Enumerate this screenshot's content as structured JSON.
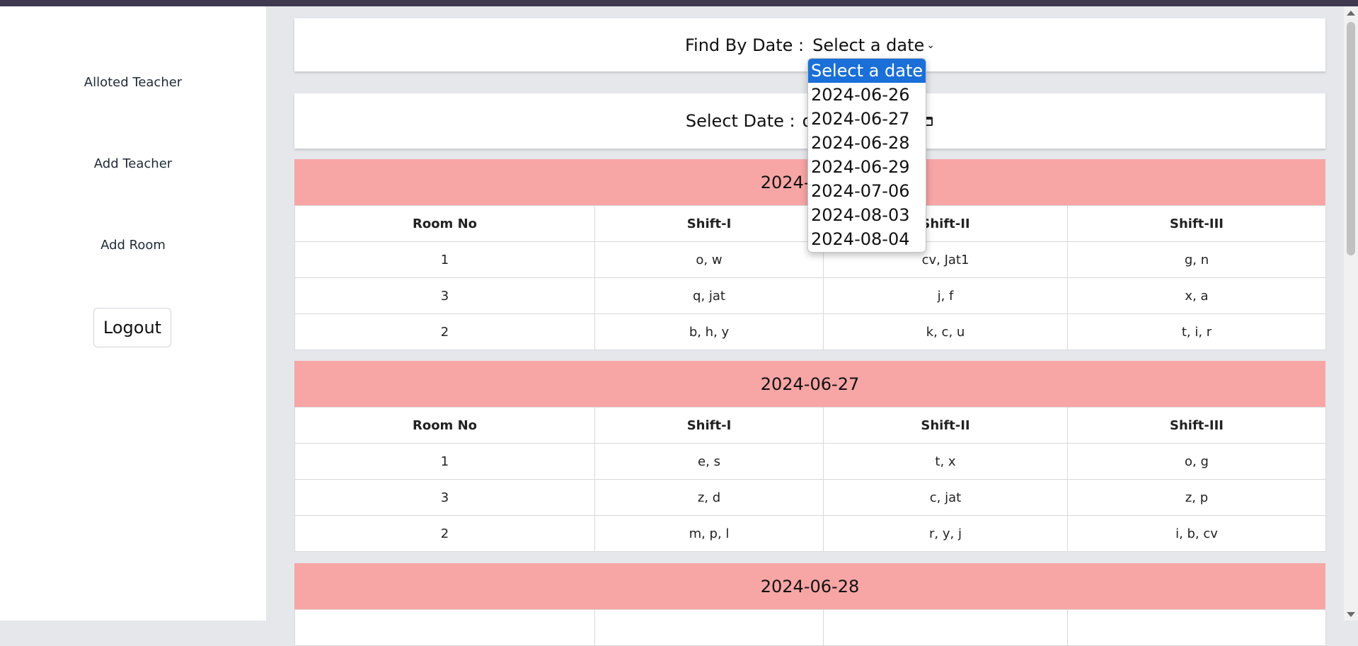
{
  "sidebar": {
    "links": [
      {
        "label": "Alloted Teacher"
      },
      {
        "label": "Add Teacher"
      },
      {
        "label": "Add Room"
      }
    ],
    "logout_label": "Logout"
  },
  "find_by_date": {
    "label": "Find By Date :",
    "select_value": "Select a date",
    "options": [
      "Select a date",
      "2024-06-26",
      "2024-06-27",
      "2024-06-28",
      "2024-06-29",
      "2024-07-06",
      "2024-08-03",
      "2024-08-04"
    ]
  },
  "select_date": {
    "label": "Select Date :",
    "input_value": "dd"
  },
  "columns": [
    "Room No",
    "Shift-I",
    "Shift-II",
    "Shift-III"
  ],
  "days": [
    {
      "date": "2024-06-26",
      "rows": [
        [
          "1",
          "o, w",
          "cv, Jat1",
          "g, n"
        ],
        [
          "3",
          "q, jat",
          "j, f",
          "x, a"
        ],
        [
          "2",
          "b, h, y",
          "k, c, u",
          "t, i, r"
        ]
      ]
    },
    {
      "date": "2024-06-27",
      "rows": [
        [
          "1",
          "e, s",
          "t, x",
          "o, g"
        ],
        [
          "3",
          "z, d",
          "c, jat",
          "z, p"
        ],
        [
          "2",
          "m, p, l",
          "r, y, j",
          "i, b, cv"
        ]
      ]
    },
    {
      "date": "2024-06-28",
      "rows": []
    }
  ],
  "colors": {
    "day_header_bg": "#f8a5a5",
    "selected_option_bg": "#1a6fd8"
  }
}
